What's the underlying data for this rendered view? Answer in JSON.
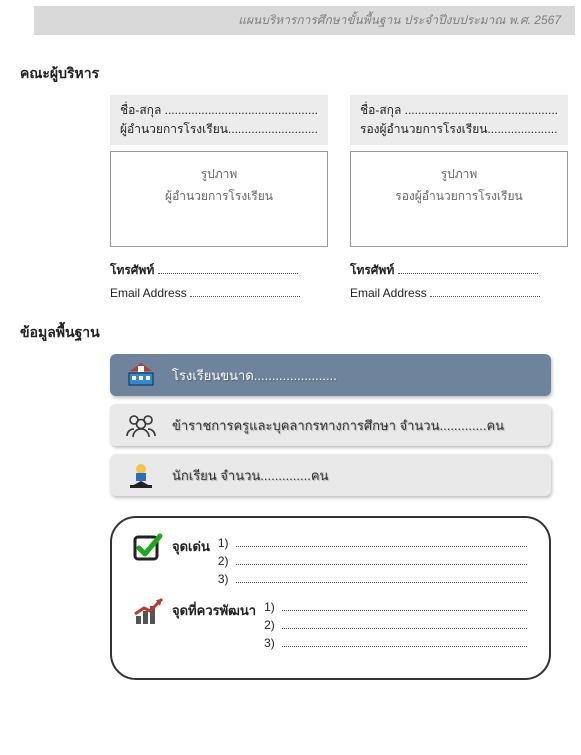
{
  "header": {
    "title": "แผนบริหารการศึกษาขั้นพื้นฐาน ประจำปีงบประมาณ พ.ศ. 2567"
  },
  "sections": {
    "administrators_title": "คณะผู้บริหาร",
    "basic_info_title": "ข้อมูลพื้นฐาน"
  },
  "admin": {
    "left": {
      "name_label": "ชื่อ-สกุล ..............................................",
      "role_label": "ผู้อำนวยการโรงเรียน...........................",
      "photo_label": "รูปภาพ",
      "photo_role": "ผู้อำนวยการโรงเรียน",
      "phone_label": "โทรศัพท์",
      "email_label": "Email Address"
    },
    "right": {
      "name_label": "ชื่อ-สกุล ..............................................",
      "role_label": "รองผู้อำนวยการโรงเรียน.....................",
      "photo_label": "รูปภาพ",
      "photo_role": "รองผู้อำนวยการโรงเรียน",
      "phone_label": "โทรศัพท์",
      "email_label": "Email Address"
    }
  },
  "pills": {
    "school_size": "โรงเรียนขนาด.......................",
    "staff": "ข้าราชการครูและบุคลากรทางการศึกษา จำนวน.............คน",
    "students": "นักเรียน จำนวน..............คน"
  },
  "roundbox": {
    "strengths_label": "จุดเด่น",
    "improve_label": "จุดที่ควรพัฒนา",
    "nums": {
      "n1": "1)",
      "n2": "2)",
      "n3": "3)"
    }
  }
}
